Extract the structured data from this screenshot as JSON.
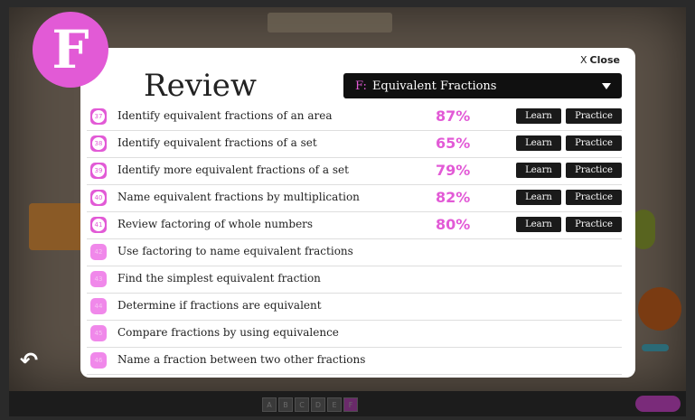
{
  "modal": {
    "badge_letter": "F",
    "title": "Review",
    "close_label": "Close",
    "close_x": "X",
    "dropdown_prefix": "F:",
    "dropdown_label": "Equivalent Fractions",
    "rows": [
      {
        "num": "37",
        "label": "Identify equivalent fractions of an area",
        "score": "87%",
        "learn": "Learn",
        "practice": "Practice",
        "locked": false
      },
      {
        "num": "38",
        "label": "Identify equivalent fractions of a set",
        "score": "65%",
        "learn": "Learn",
        "practice": "Practice",
        "locked": false
      },
      {
        "num": "39",
        "label": "Identify more equivalent fractions of a set",
        "score": "79%",
        "learn": "Learn",
        "practice": "Practice",
        "locked": false
      },
      {
        "num": "40",
        "label": "Name equivalent fractions by multiplication",
        "score": "82%",
        "learn": "Learn",
        "practice": "Practice",
        "locked": false
      },
      {
        "num": "41",
        "label": "Review factoring of whole numbers",
        "score": "80%",
        "learn": "Learn",
        "practice": "Practice",
        "locked": false
      },
      {
        "num": "42",
        "label": "Use factoring to name equivalent fractions",
        "locked": true
      },
      {
        "num": "43",
        "label": "Find the simplest equivalent fraction",
        "locked": true
      },
      {
        "num": "44",
        "label": "Determine if fractions are equivalent",
        "locked": true
      },
      {
        "num": "45",
        "label": "Compare fractions by using equivalence",
        "locked": true
      },
      {
        "num": "46",
        "label": "Name a fraction between two other fractions",
        "locked": true
      }
    ]
  },
  "bottombar": {
    "letters": [
      "A",
      "B",
      "C",
      "D",
      "E",
      "F"
    ],
    "active_letter": "F"
  },
  "colors": {
    "accent": "#e25ad6",
    "dropdown_bg": "#101010",
    "button_bg": "#1a1a1a"
  }
}
